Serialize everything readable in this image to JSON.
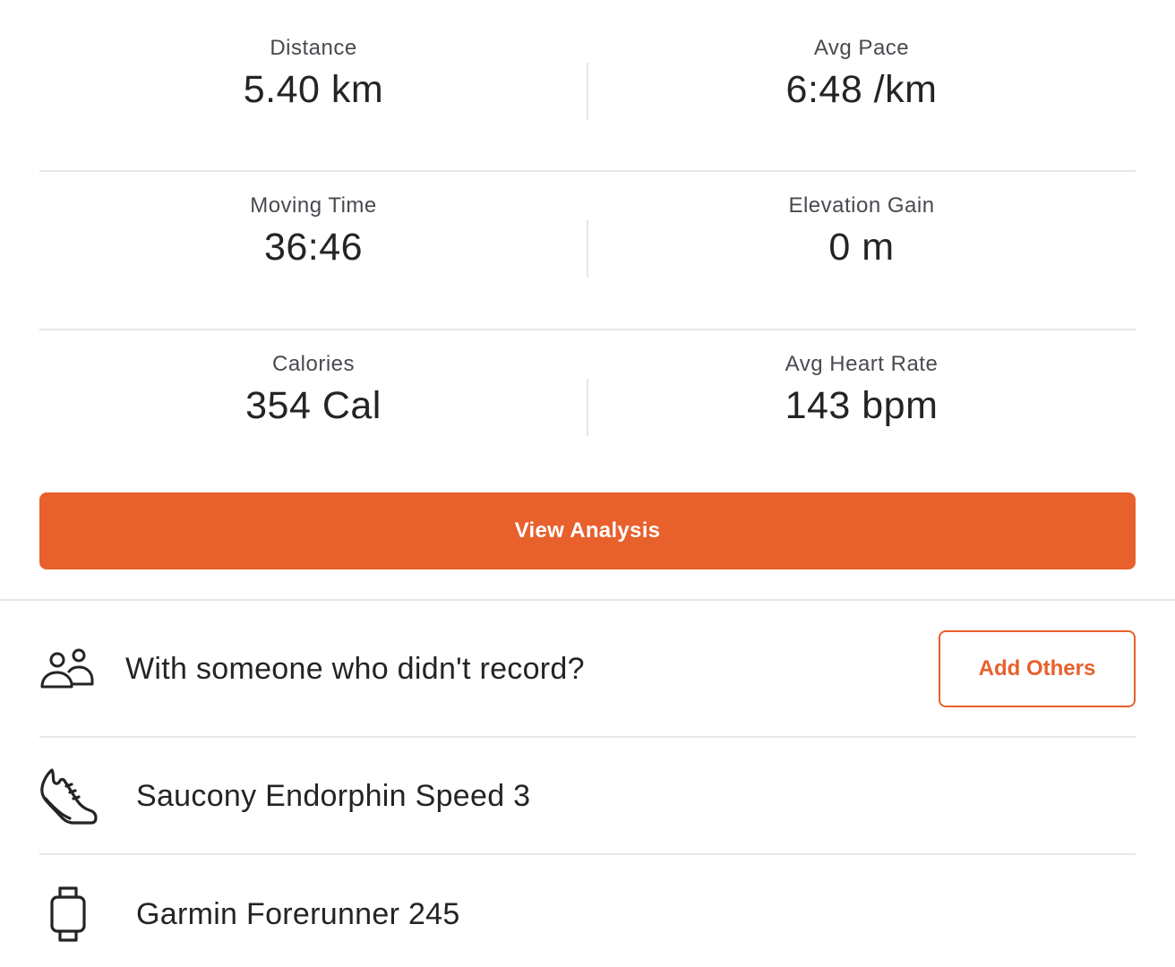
{
  "stats": [
    {
      "label": "Distance",
      "value": "5.40 km"
    },
    {
      "label": "Avg Pace",
      "value": "6:48 /km"
    },
    {
      "label": "Moving Time",
      "value": "36:46"
    },
    {
      "label": "Elevation Gain",
      "value": "0 m"
    },
    {
      "label": "Calories",
      "value": "354 Cal"
    },
    {
      "label": "Avg Heart Rate",
      "value": "143 bpm"
    }
  ],
  "actions": {
    "view_analysis": "View Analysis",
    "add_others": "Add Others"
  },
  "companions": {
    "prompt": "With someone who didn't record?",
    "icon": "people-icon"
  },
  "gear": {
    "shoe": {
      "name": "Saucony Endorphin Speed 3",
      "icon": "shoe-icon"
    },
    "device": {
      "name": "Garmin Forerunner 245",
      "icon": "watch-icon"
    }
  },
  "colors": {
    "accent": "#e8602c",
    "text_primary": "#242428",
    "text_secondary": "#494950",
    "divider": "#e6e6ea"
  }
}
